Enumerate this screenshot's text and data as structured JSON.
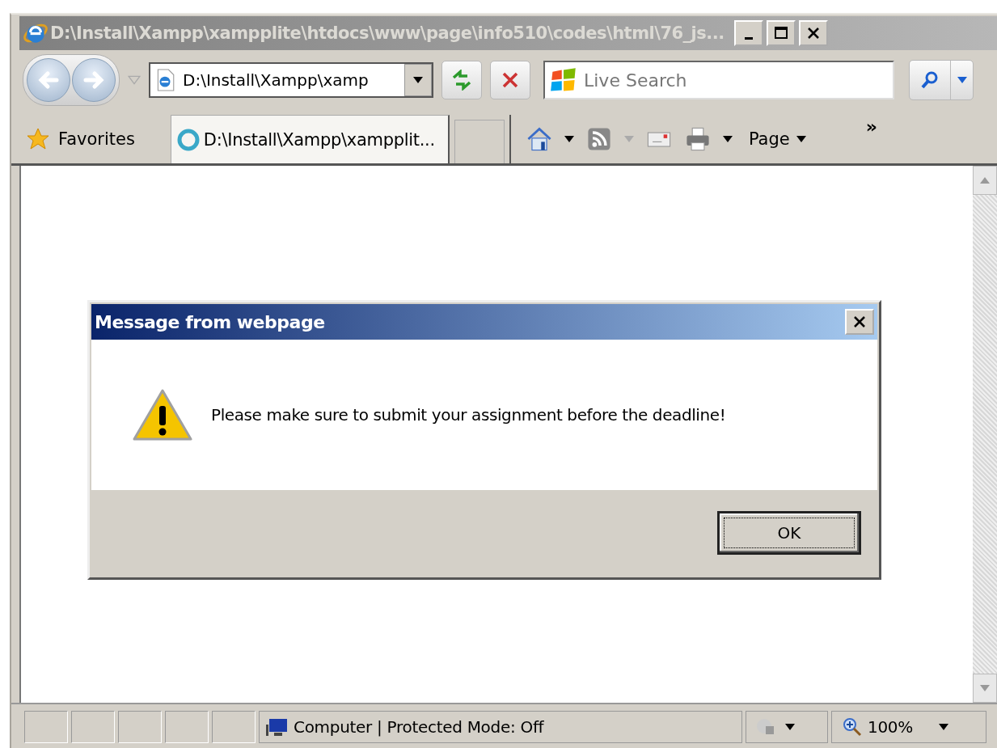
{
  "window": {
    "title": "D:\\Install\\Xampp\\xampplite\\htdocs\\www\\page\\info510\\codes\\html\\76_js..."
  },
  "address_bar": {
    "value": "D:\\Install\\Xampp\\xamp"
  },
  "search": {
    "placeholder": "Live Search"
  },
  "favorites": {
    "label": "Favorites"
  },
  "tabs": [
    {
      "label": "D:\\Install\\Xampp\\xampplit...",
      "selected": true
    }
  ],
  "command_bar": {
    "page_menu": "Page",
    "overflow": "»"
  },
  "dialog": {
    "title": "Message from webpage",
    "message": "Please make sure to submit your assignment before the deadline!",
    "buttons": [
      {
        "label": "OK",
        "focused": true
      }
    ]
  },
  "status_bar": {
    "zone": "Computer | Protected Mode: Off",
    "zoom": "100%"
  }
}
